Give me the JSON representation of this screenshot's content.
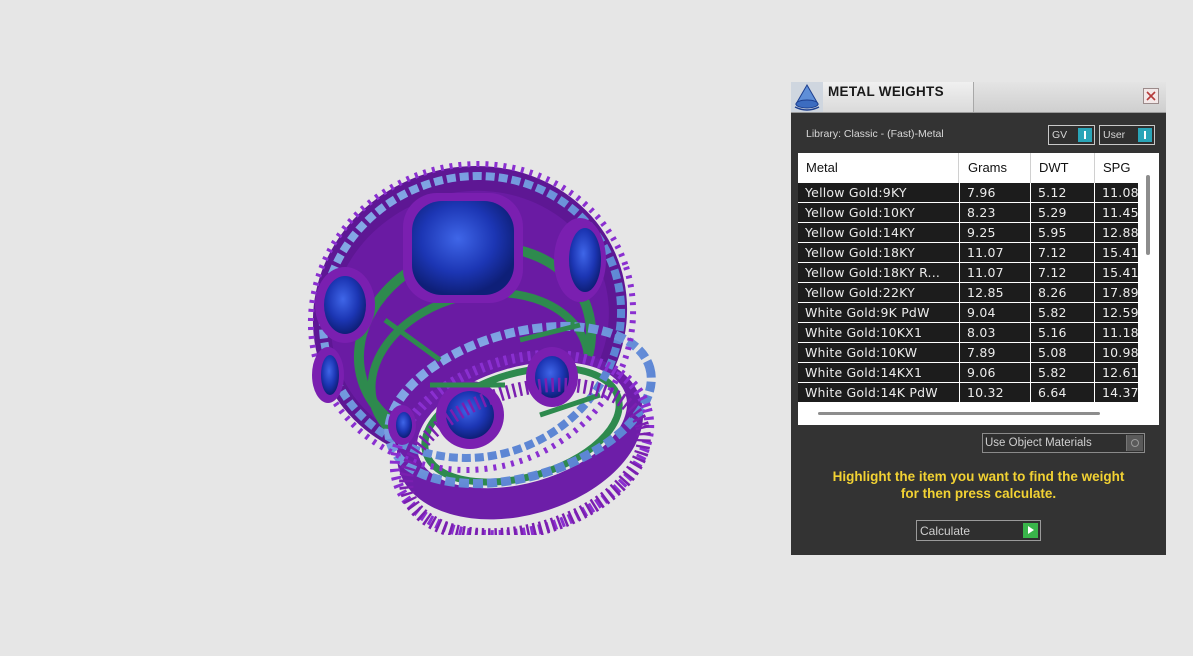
{
  "panel": {
    "title": "METAL WEIGHTS",
    "library": "Library: Classic - (Fast)-Metal",
    "toggles": {
      "gv": "GV",
      "user": "User"
    },
    "columns": [
      "Metal",
      "Grams",
      "DWT",
      "SPG"
    ],
    "rows": [
      [
        "Yellow Gold:9KY",
        "7.96",
        "5.12",
        "11.08"
      ],
      [
        "Yellow Gold:10KY",
        "8.23",
        "5.29",
        "11.45"
      ],
      [
        "Yellow Gold:14KY",
        "9.25",
        "5.95",
        "12.88"
      ],
      [
        "Yellow Gold:18KY",
        "11.07",
        "7.12",
        "15.41"
      ],
      [
        "Yellow Gold:18KY R...",
        "11.07",
        "7.12",
        "15.41"
      ],
      [
        "Yellow Gold:22KY",
        "12.85",
        "8.26",
        "17.89"
      ],
      [
        "White Gold:9K PdW",
        "9.04",
        "5.82",
        "12.59"
      ],
      [
        "White Gold:10KX1",
        "8.03",
        "5.16",
        "11.18"
      ],
      [
        "White Gold:10KW",
        "7.89",
        "5.08",
        "10.98"
      ],
      [
        "White Gold:14KX1",
        "9.06",
        "5.82",
        "12.61"
      ],
      [
        "White Gold:14K PdW",
        "10.32",
        "6.64",
        "14.37"
      ]
    ],
    "use_object_materials": "Use Object Materials",
    "instructions_line1": "Highlight the item you want to find the weight",
    "instructions_line2": "for then press calculate.",
    "calculate_label": "Calculate"
  },
  "colors": {
    "panel_bg": "#333333",
    "instructions": "#f2d233",
    "toggle_accent": "#2aa5b8",
    "play_button": "#39b54a",
    "ring_metal": "#7a1fb0",
    "ring_prongs": "#2e8a4e",
    "ring_stones": "#1f3fbf"
  },
  "icons": {
    "app": "rhino-cone-icon",
    "close": "close-icon",
    "play": "play-icon"
  }
}
